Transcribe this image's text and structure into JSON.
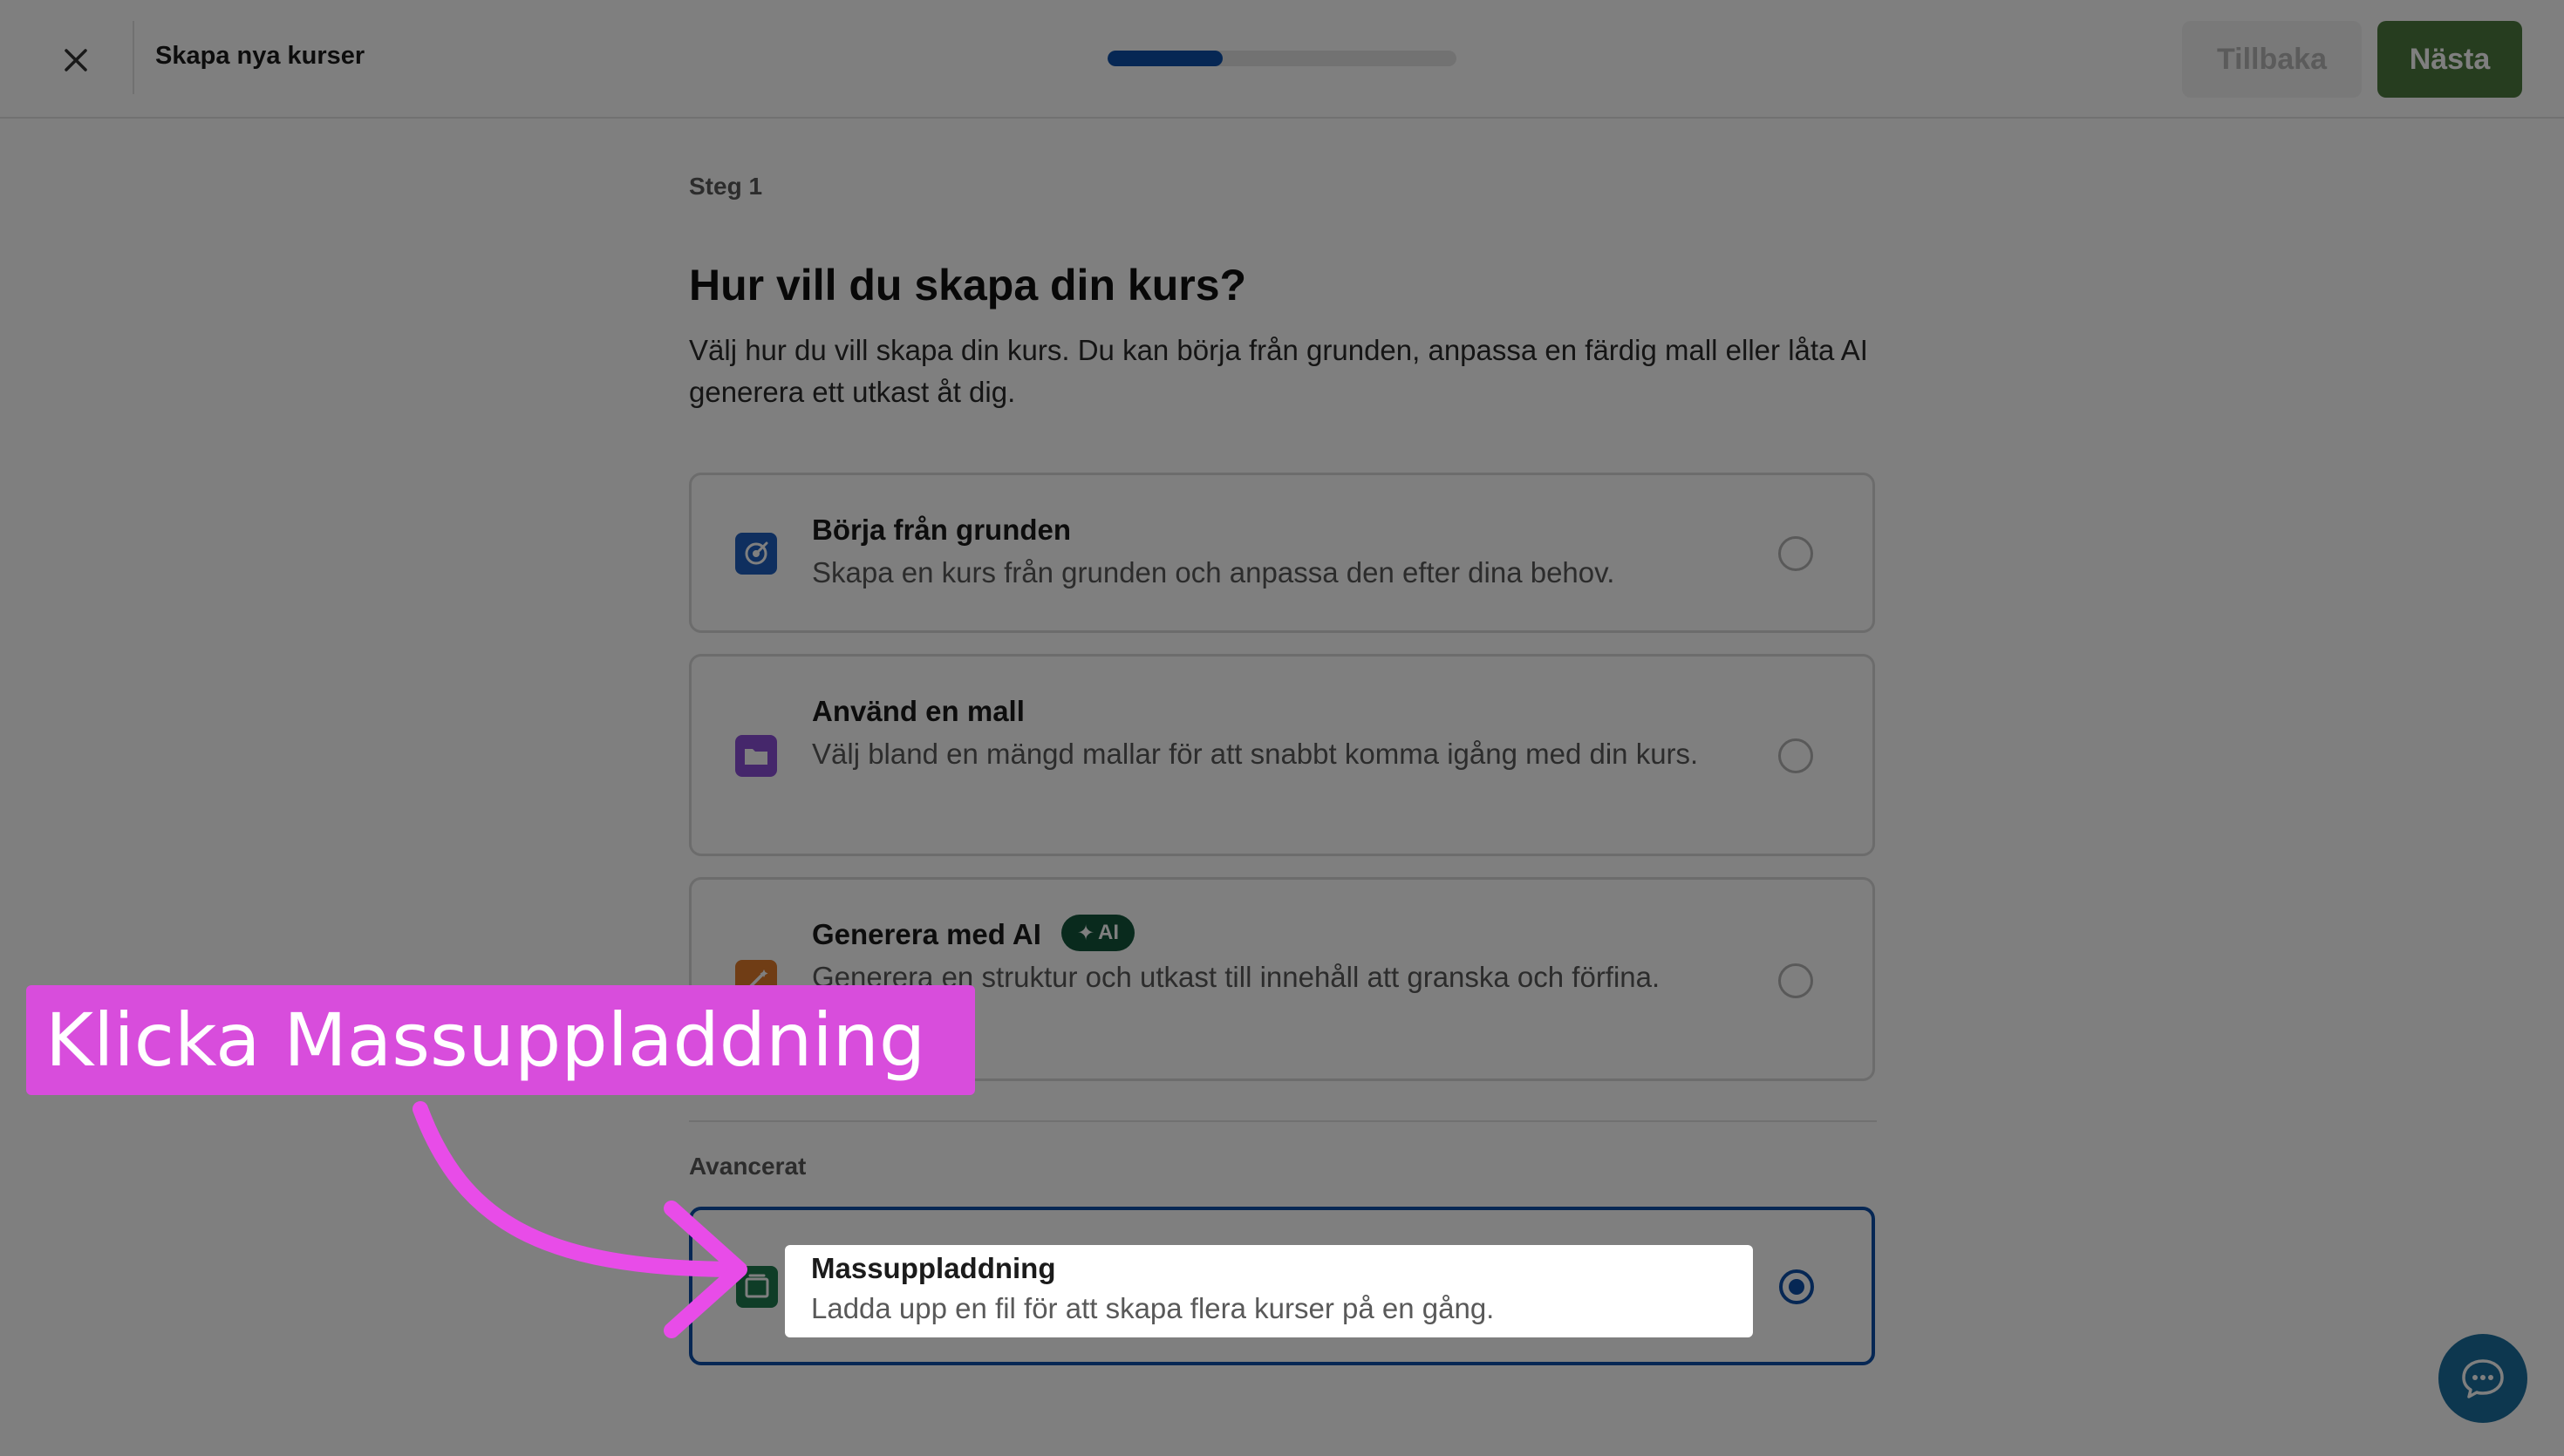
{
  "header": {
    "title": "Skapa nya kurser",
    "progress_fraction": 0.33,
    "back_label": "Tillbaka",
    "next_label": "Nästa",
    "close_icon": "close-icon"
  },
  "main": {
    "step_label": "Steg 1",
    "heading": "Hur vill du skapa din kurs?",
    "subheading": "Välj hur du vill skapa din kurs. Du kan börja från grunden, anpassa en färdig mall eller låta AI generera ett utkast åt dig.",
    "options": [
      {
        "title": "Börja från grunden",
        "description": "Skapa en kurs från grunden och anpassa den efter dina behov.",
        "icon": "target-icon",
        "icon_color": "#1f5fbf",
        "selected": false
      },
      {
        "title": "Använd en mall",
        "description": "Välj bland en mängd mallar för att snabbt komma igång med din kurs.",
        "icon": "folder-icon",
        "icon_color": "#8a4fd6",
        "selected": false
      },
      {
        "title": "Generera med AI",
        "badge": "AI",
        "description": "Generera en struktur och utkast till innehåll att granska och förfina.",
        "icon": "magic-wand-icon",
        "icon_color": "#e07a2a",
        "selected": false
      }
    ],
    "advanced_label": "Avancerat",
    "bulk_option": {
      "title": "Massuppladdning",
      "description": "Ladda upp en fil för att skapa flera kurser på en gång.",
      "icon": "bulk-upload-icon",
      "icon_color": "#1f7a4f",
      "selected": true
    }
  },
  "overlay": {
    "callout_text": "Klicka Massuppladdning",
    "callout_color": "#d84ddc"
  },
  "chat": {
    "icon": "chat-bubble-icon",
    "color": "#1b6e9e"
  }
}
